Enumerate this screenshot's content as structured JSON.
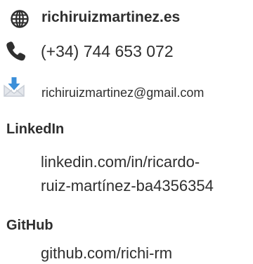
{
  "contact": {
    "website": {
      "icon": "globe-icon",
      "text": "richiruizmartinez.es"
    },
    "phone": {
      "icon": "phone-icon",
      "text": "(+34) 744 653 072"
    },
    "email": {
      "icon": "mail-download-icon",
      "text": "richiruizmartinez@gmail.com"
    }
  },
  "linkedin": {
    "heading": "LinkedIn",
    "lines": [
      "linkedin.com/in/ricardo-",
      "ruiz-martínez-ba4356354"
    ]
  },
  "github": {
    "heading": "GitHub",
    "url": "github.com/richi-rm"
  },
  "colors": {
    "text": "#2f2f2f",
    "email_icon_blue": "#3b8fd9",
    "email_icon_grey": "#c9ced6"
  }
}
